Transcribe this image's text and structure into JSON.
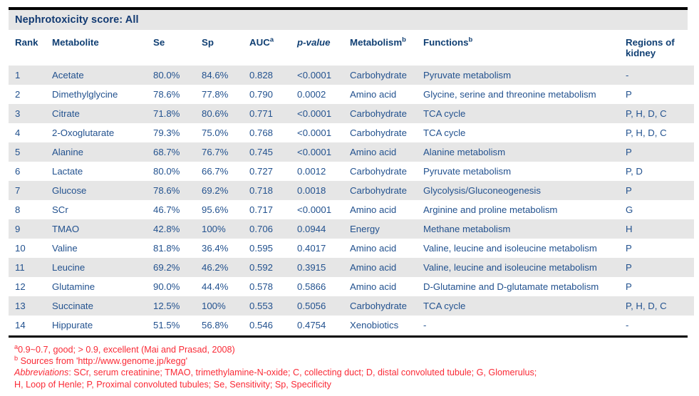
{
  "table": {
    "caption": "Nephrotoxicity score: All",
    "columns": [
      {
        "key": "rank",
        "label": "Rank",
        "sup": ""
      },
      {
        "key": "metabolite",
        "label": "Metabolite",
        "sup": ""
      },
      {
        "key": "se",
        "label": "Se",
        "sup": ""
      },
      {
        "key": "sp",
        "label": "Sp",
        "sup": ""
      },
      {
        "key": "auc",
        "label": "AUC",
        "sup": "a"
      },
      {
        "key": "pvalue",
        "label": "p-value",
        "sup": ""
      },
      {
        "key": "metabolism",
        "label": "Metabolism",
        "sup": "b"
      },
      {
        "key": "functions",
        "label": "Functions",
        "sup": "b"
      },
      {
        "key": "regions",
        "label": "Regions of kidney",
        "sup": ""
      }
    ],
    "rows": [
      {
        "rank": "1",
        "metabolite": "Acetate",
        "se": "80.0%",
        "sp": "84.6%",
        "auc": "0.828",
        "auc_highlight": true,
        "pvalue": "<0.0001",
        "metabolism": "Carbohydrate",
        "functions": "Pyruvate metabolism",
        "regions": "-"
      },
      {
        "rank": "2",
        "metabolite": "Dimethylglycine",
        "se": "78.6%",
        "sp": "77.8%",
        "auc": "0.790",
        "auc_highlight": true,
        "pvalue": "0.0002",
        "metabolism": "Amino acid",
        "functions": "Glycine, serine and threonine metabolism",
        "regions": "P"
      },
      {
        "rank": "3",
        "metabolite": "Citrate",
        "se": "71.8%",
        "sp": "80.6%",
        "auc": "0.771",
        "auc_highlight": true,
        "pvalue": "<0.0001",
        "metabolism": "Carbohydrate",
        "functions": "TCA cycle",
        "regions": "P, H, D, C"
      },
      {
        "rank": "4",
        "metabolite": "2-Oxoglutarate",
        "se": "79.3%",
        "sp": "75.0%",
        "auc": "0.768",
        "auc_highlight": true,
        "pvalue": "<0.0001",
        "metabolism": "Carbohydrate",
        "functions": "TCA cycle",
        "regions": "P, H, D, C"
      },
      {
        "rank": "5",
        "metabolite": "Alanine",
        "se": "68.7%",
        "sp": "76.7%",
        "auc": "0.745",
        "auc_highlight": true,
        "pvalue": "<0.0001",
        "metabolism": "Amino acid",
        "functions": "Alanine metabolism",
        "regions": "P"
      },
      {
        "rank": "6",
        "metabolite": "Lactate",
        "se": "80.0%",
        "sp": "66.7%",
        "auc": "0.727",
        "auc_highlight": true,
        "pvalue": "0.0012",
        "metabolism": "Carbohydrate",
        "functions": "Pyruvate metabolism",
        "regions": "P, D"
      },
      {
        "rank": "7",
        "metabolite": "Glucose",
        "se": "78.6%",
        "sp": "69.2%",
        "auc": "0.718",
        "auc_highlight": true,
        "pvalue": "0.0018",
        "metabolism": "Carbohydrate",
        "functions": "Glycolysis/Gluconeogenesis",
        "regions": "P"
      },
      {
        "rank": "8",
        "metabolite": "SCr",
        "se": "46.7%",
        "sp": "95.6%",
        "auc": "0.717",
        "auc_highlight": true,
        "pvalue": "<0.0001",
        "metabolism": "Amino acid",
        "functions": "Arginine and proline metabolism",
        "regions": "G"
      },
      {
        "rank": "9",
        "metabolite": "TMAO",
        "se": "42.8%",
        "sp": "100%",
        "auc": "0.706",
        "auc_highlight": true,
        "pvalue": "0.0944",
        "metabolism": "Energy",
        "functions": "Methane metabolism",
        "regions": "H"
      },
      {
        "rank": "10",
        "metabolite": "Valine",
        "se": "81.8%",
        "sp": "36.4%",
        "auc": "0.595",
        "auc_highlight": false,
        "pvalue": "0.4017",
        "metabolism": "Amino acid",
        "functions": "Valine, leucine and isoleucine metabolism",
        "regions": "P"
      },
      {
        "rank": "11",
        "metabolite": "Leucine",
        "se": "69.2%",
        "sp": "46.2%",
        "auc": "0.592",
        "auc_highlight": false,
        "pvalue": "0.3915",
        "metabolism": "Amino acid",
        "functions": "Valine, leucine and isoleucine metabolism",
        "regions": "P"
      },
      {
        "rank": "12",
        "metabolite": "Glutamine",
        "se": "90.0%",
        "sp": "44.4%",
        "auc": "0.578",
        "auc_highlight": false,
        "pvalue": "0.5866",
        "metabolism": "Amino acid",
        "functions": "D-Glutamine and D-glutamate metabolism",
        "regions": "P"
      },
      {
        "rank": "13",
        "metabolite": "Succinate",
        "se": "12.5%",
        "sp": "100%",
        "auc": "0.553",
        "auc_highlight": false,
        "pvalue": "0.5056",
        "metabolism": "Carbohydrate",
        "functions": "TCA cycle",
        "regions": "P, H, D, C"
      },
      {
        "rank": "14",
        "metabolite": "Hippurate",
        "se": "51.5%",
        "sp": "56.8%",
        "auc": "0.546",
        "auc_highlight": false,
        "pvalue": "0.4754",
        "metabolism": "Xenobiotics",
        "functions": "-",
        "regions": "-"
      }
    ]
  },
  "footnotes": {
    "line_a_sup": "a",
    "line_a": "0.9~0.7, good; > 0.9, excellent (Mai and Prasad, 2008)",
    "line_b_sup": "b",
    "line_b": " Sources from 'http://www.genome.jp/kegg'",
    "abbrev_label": "Abbreviations",
    "abbrev_line1": ": SCr, serum creatinine; TMAO, trimethylamine-N-oxide; C, collecting duct; D, distal convoluted tubule; G, Glomerulus;",
    "abbrev_line2": "H, Loop of Henle; P, Proximal convoluted tubules; Se, Sensitivity; Sp, Specificity"
  },
  "colors": {
    "rule": "#000000",
    "caption_bg": "#e6e6e6",
    "header_text": "#103f73",
    "body_text": "#23528f",
    "auc_highlight": "#d2201c",
    "footnote": "#fa2a36",
    "row_alt_bg": "#e6e6e6"
  }
}
